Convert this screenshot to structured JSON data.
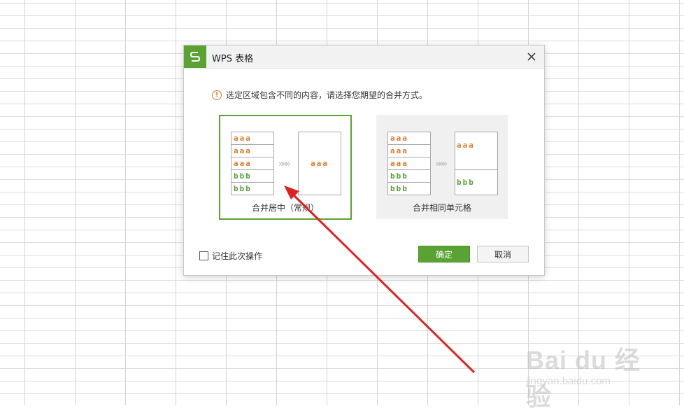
{
  "dialog": {
    "title": "WPS 表格",
    "message": "选定区域包含不同的内容，请选择您期望的合并方式。",
    "options": [
      {
        "label": "合并居中（常规）",
        "selected": true,
        "rows": [
          "aaa",
          "aaa",
          "aaa",
          "bbb",
          "bbb"
        ],
        "result": [
          "aaa"
        ]
      },
      {
        "label": "合并相同单元格",
        "selected": false,
        "rows": [
          "aaa",
          "aaa",
          "aaa",
          "bbb",
          "bbb"
        ],
        "result": [
          "aaa",
          "bbb"
        ]
      }
    ],
    "remember_label": "记住此次操作",
    "remember_checked": false,
    "ok_label": "确定",
    "cancel_label": "取消"
  },
  "arrows_glyph": "»»»",
  "watermark": {
    "main": "Bai du 经验",
    "sub": "jingyan.baidu.com"
  },
  "colors": {
    "accent": "#5aa332",
    "warning": "#e8712d",
    "value_a": "#e07a2a",
    "value_b": "#5a9e3a",
    "annotation": "#e02020"
  }
}
